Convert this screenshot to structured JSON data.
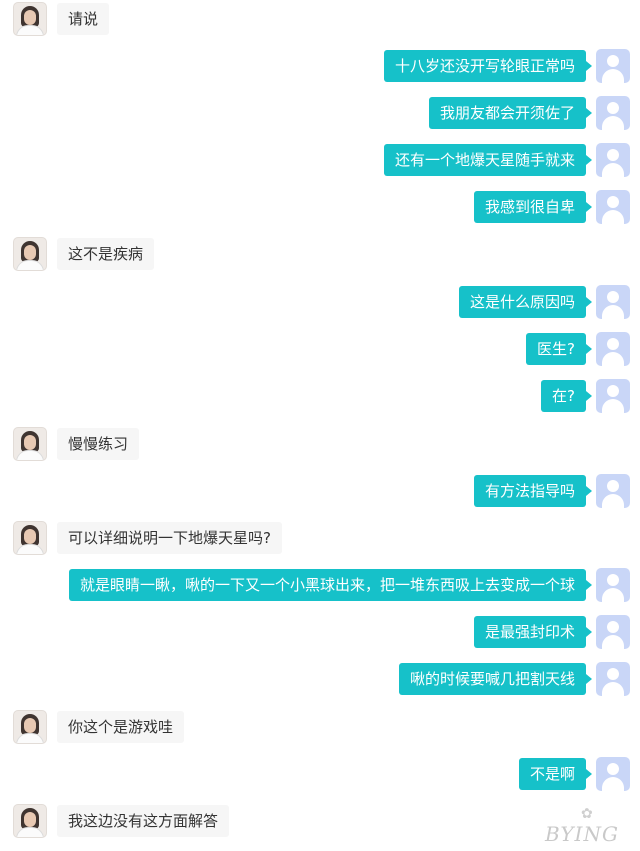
{
  "messages": [
    {
      "sender": "doctor",
      "text": "请说"
    },
    {
      "sender": "user",
      "text": "十八岁还没开写轮眼正常吗"
    },
    {
      "sender": "user",
      "text": "我朋友都会开须佐了"
    },
    {
      "sender": "user",
      "text": "还有一个地爆天星随手就来"
    },
    {
      "sender": "user",
      "text": "我感到很自卑"
    },
    {
      "sender": "doctor",
      "text": "这不是疾病"
    },
    {
      "sender": "user",
      "text": "这是什么原因吗"
    },
    {
      "sender": "user",
      "text": "医生?"
    },
    {
      "sender": "user",
      "text": "在?"
    },
    {
      "sender": "doctor",
      "text": "慢慢练习"
    },
    {
      "sender": "user",
      "text": "有方法指导吗"
    },
    {
      "sender": "doctor",
      "text": "可以详细说明一下地爆天星吗?"
    },
    {
      "sender": "user",
      "text": "就是眼睛一瞅，啾的一下又一个小黑球出来，把一堆东西吸上去变成一个球"
    },
    {
      "sender": "user",
      "text": "是最强封印术"
    },
    {
      "sender": "user",
      "text": "啾的时候要喊几把割天线"
    },
    {
      "sender": "doctor",
      "text": "你这个是游戏哇"
    },
    {
      "sender": "user",
      "text": "不是啊"
    },
    {
      "sender": "doctor",
      "text": "我这边没有这方面解答"
    }
  ],
  "watermark": {
    "text": "BYING",
    "icon": "flower-icon"
  },
  "colors": {
    "user_bubble": "#16c1c9",
    "doctor_bubble": "#f6f6f6",
    "user_avatar": "#c9d6f7"
  }
}
